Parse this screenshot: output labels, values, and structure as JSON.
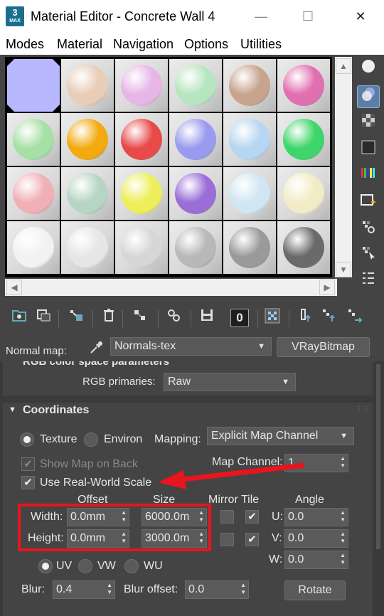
{
  "window": {
    "app_badge": "3",
    "app_badge_sub": "MAX",
    "title": "Material Editor - Concrete Wall 4",
    "min": "—",
    "max": "☐",
    "close": "✕"
  },
  "menu": [
    "Modes",
    "Material",
    "Navigation",
    "Options",
    "Utilities"
  ],
  "sample_slots": [
    "#b8b8ff",
    "#e9cdb6",
    "#e6b6e6",
    "#b6e6bf",
    "#c7a48e",
    "#e070b0",
    "#a6e0a6",
    "#f2aa10",
    "#e84a4a",
    "#9a9aee",
    "#b6d6f2",
    "#3ed66a",
    "#f0b0b6",
    "#b6d6c3",
    "#eeee5a",
    "#9a6ed6",
    "#d0e6f2",
    "#f2ecc6",
    "#f2f2f2",
    "#e6e6e6",
    "#d6d6d6",
    "#b8b8b8",
    "#9a9a9a",
    "#6a6a6a"
  ],
  "scroll": {
    "up": "▲",
    "down": "▼",
    "left": "◀",
    "right": "▶"
  },
  "side_tools": [
    "sphere-icon",
    "backlight-icon",
    "background-checker-icon",
    "sample-uv-icon",
    "video-color-check-icon",
    "make-preview-icon",
    "options-icon",
    "select-by-material-icon",
    "material-navigator-icon"
  ],
  "toolbar": {
    "tools": [
      "get-material-icon",
      "put-to-scene-icon",
      "assign-to-selection-icon",
      "delete-icon",
      "make-unique-icon",
      "copy-material-icon",
      "save-to-library-icon",
      "material-id-channel-icon",
      "show-map-icon",
      "go-to-parent-icon",
      "go-forward-icon",
      "pick-material-icon"
    ],
    "material_id": "0"
  },
  "map_row": {
    "label": "Normal map:",
    "eyedropper_icon": "eyedropper-icon",
    "map_name": "Normals-tex",
    "map_type_button": "VRayBitmap"
  },
  "color_space": {
    "header": "RGB color space parameters",
    "primaries_label": "RGB primaries:",
    "primaries_value": "Raw"
  },
  "coordinates": {
    "header": "Coordinates",
    "texture_label": "Texture",
    "environ_label": "Environ",
    "mapping_label": "Mapping:",
    "mapping_value": "Explicit Map Channel",
    "show_map_on_back": "Show Map on Back",
    "map_channel_label": "Map Channel:",
    "map_channel_value": "1",
    "use_real_world_scale": "Use Real-World Scale",
    "col_offset": "Offset",
    "col_size": "Size",
    "col_mirror": "Mirror",
    "col_tile": "Tile",
    "col_angle": "Angle",
    "width_label": "Width:",
    "height_label": "Height:",
    "width_offset": "0.0mm",
    "height_offset": "0.0mm",
    "width_size": "6000.0m",
    "height_size": "3000.0m",
    "angle_u_label": "U:",
    "angle_v_label": "V:",
    "angle_w_label": "W:",
    "angle_u": "0.0",
    "angle_v": "0.0",
    "angle_w": "0.0",
    "uv_label": "UV",
    "vw_label": "VW",
    "wu_label": "WU",
    "blur_label": "Blur:",
    "blur_value": "0.4",
    "blur_offset_label": "Blur offset:",
    "blur_offset_value": "0.0",
    "rotate_button": "Rotate"
  }
}
